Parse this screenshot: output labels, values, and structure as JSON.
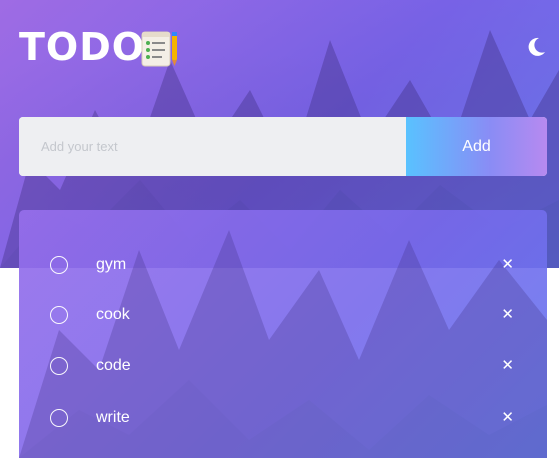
{
  "header": {
    "title": "TODO",
    "icon": "checklist-notepad-icon",
    "theme_toggle_icon": "moon-icon"
  },
  "add_bar": {
    "placeholder": "Add your text",
    "value": "",
    "button_label": "Add"
  },
  "todos": [
    {
      "text": "gym",
      "completed": false
    },
    {
      "text": "cook",
      "completed": false
    },
    {
      "text": "code",
      "completed": false
    },
    {
      "text": "write",
      "completed": false
    }
  ],
  "delete_glyph": "✕",
  "colors": {
    "accent_start": "#59c2ff",
    "accent_end": "#b78af0",
    "hero_purple": "#7b5ed8"
  }
}
